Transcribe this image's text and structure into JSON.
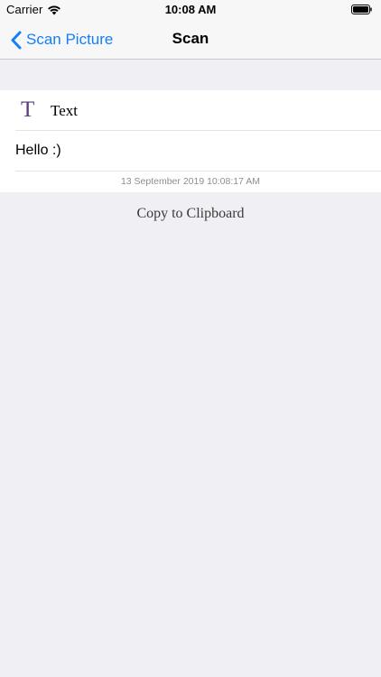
{
  "status_bar": {
    "carrier": "Carrier",
    "time": "10:08 AM",
    "wifi_icon": "wifi-icon",
    "battery_icon": "battery-icon"
  },
  "nav": {
    "back_label": "Scan Picture",
    "back_icon": "chevron-left-icon",
    "title": "Scan",
    "accent_color": "#157efb"
  },
  "result": {
    "type_icon": "T",
    "type_label": "Text",
    "content": "Hello :)",
    "timestamp": "13 September 2019 10:08:17 AM"
  },
  "actions": {
    "copy_label": "Copy to Clipboard"
  },
  "colors": {
    "background": "#efeff4",
    "card": "#ffffff",
    "type_icon": "#5b3c7a"
  }
}
